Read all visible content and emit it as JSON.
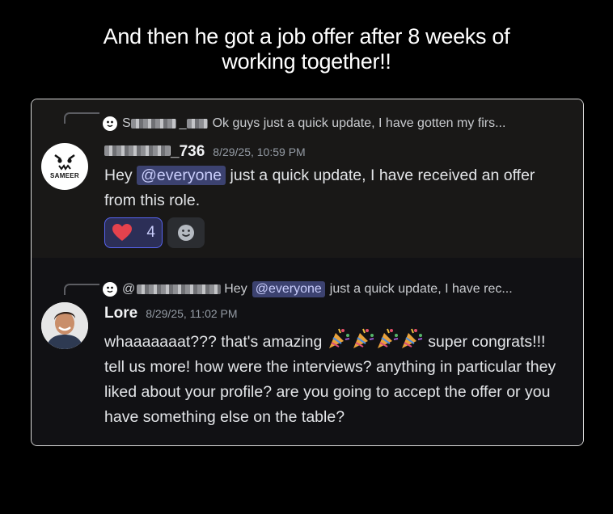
{
  "headline": {
    "line1": "And then he got a job offer after 8 weeks of",
    "line2": "working together!!"
  },
  "colors": {
    "background": "#000000",
    "card_border": "#d9d9d9",
    "mention_bg": "#3c4270",
    "mention_text": "#c9cdfb",
    "reaction_border": "#5865f2"
  },
  "message1": {
    "reply": {
      "username_suffix": "_",
      "text": "Ok guys just a quick update, I have gotten my firs..."
    },
    "avatar_label": "SAMEER",
    "username": "_736",
    "timestamp": "8/29/25, 10:59 PM",
    "text_before": "Hey ",
    "mention": "@everyone",
    "text_after": "  just a quick update, I have received an offer from this role.",
    "reactions": [
      {
        "icon": "heart-icon",
        "count": "4"
      },
      {
        "icon": "add-reaction-icon"
      }
    ]
  },
  "message2": {
    "reply": {
      "prefix": "@",
      "text_before": "Hey",
      "mention": "@everyone",
      "text_after": "just a quick update, I have rec..."
    },
    "username": "Lore",
    "timestamp": "8/29/25, 11:02 PM",
    "line1_before": "whaaaaaaat??? that's amazing",
    "line1_after": "super",
    "rest": "congrats!!! tell us more! how were the interviews? anything in particular they liked about your profile? are you going to accept the offer or you have something else on the table?",
    "emoji": "party-popper-icon"
  }
}
